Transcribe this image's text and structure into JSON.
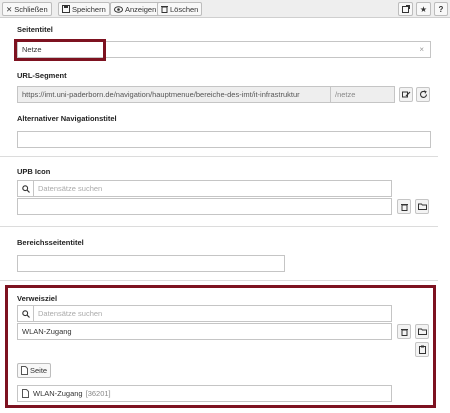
{
  "toolbar": {
    "close_label": "Schließen",
    "save_label": "Speichern",
    "view_label": "Anzeigen",
    "delete_label": "Löschen"
  },
  "fields": {
    "page_title": {
      "label": "Seitentitel",
      "value": "Netze",
      "clear": "×"
    },
    "url_segment": {
      "label": "URL-Segment",
      "value": "https://imt.uni-paderborn.de/navigation/hauptmenue/bereiche-des-imt/it-infrastruktur",
      "suffix": "/netze"
    },
    "alt_nav_title": {
      "label": "Alternativer Navigationstitel",
      "value": ""
    },
    "upb_icon": {
      "label": "UPB Icon",
      "search_placeholder": "Datensätze suchen",
      "value": ""
    },
    "area_title": {
      "label": "Bereichsseitentitel",
      "value": ""
    },
    "reference_target": {
      "label": "Verweisziel",
      "search_placeholder": "Datensätze suchen",
      "value": "WLAN-Zugang",
      "page_button_label": "Seite",
      "item_title": "WLAN-Zugang",
      "item_id": "[36201]"
    }
  },
  "icons": [
    "close-icon",
    "save-icon",
    "view-icon",
    "delete-icon",
    "open-external-icon",
    "star-icon",
    "help-icon",
    "search-icon",
    "trash-icon",
    "folder-icon",
    "clipboard-icon",
    "page-icon",
    "edit-url-icon",
    "refresh-icon"
  ],
  "colors": {
    "highlight": "#7d1220",
    "toolbar_bg": "#eeeeee"
  }
}
